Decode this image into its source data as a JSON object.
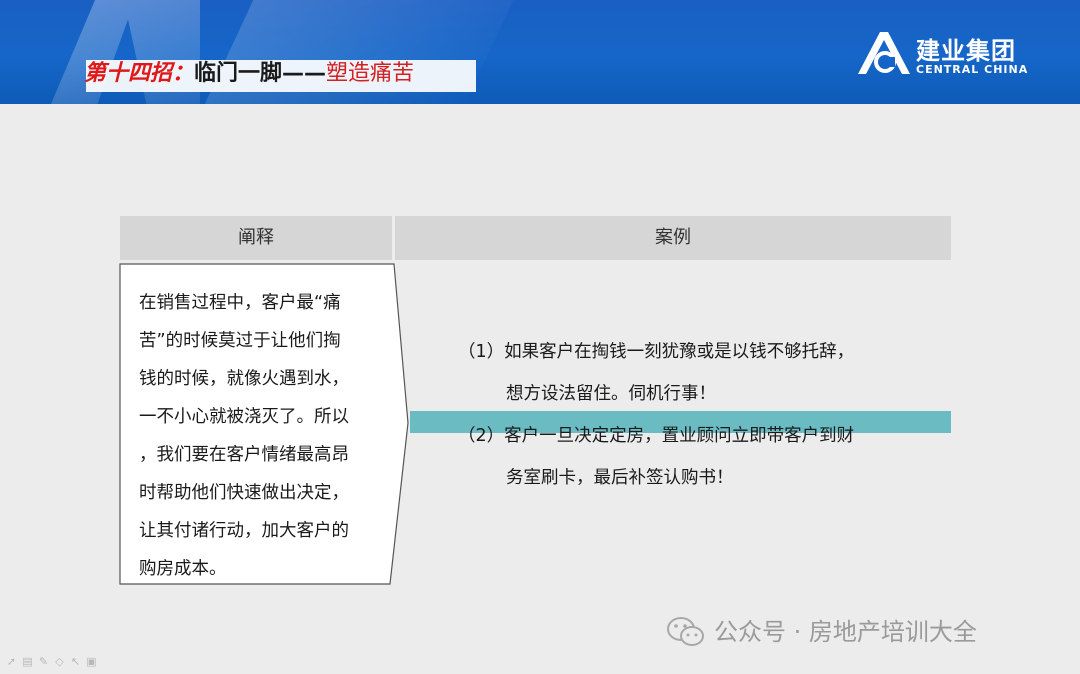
{
  "header": {
    "title_part1": "第十四招：",
    "title_part2": "临门一脚——",
    "title_part3": "塑造痛苦",
    "logo_cn": "建业集团",
    "logo_en": "CENTRAL CHINA"
  },
  "table": {
    "col_left_label": "阐释",
    "col_right_label": "案例",
    "explanation": "在销售过程中，客户最“痛\n苦”的时候莫过于让他们掏\n钱的时候，就像火遇到水，\n一不小心就被浇灭了。所以\n，我们要在客户情绪最高昂\n时帮助他们快速做出决定，\n让其付诸行动，加大客户的\n购房成本。",
    "cases": [
      {
        "line1": "（1）如果客户在掏钱一刻犹豫或是以钱不够托辞，",
        "line2": "想方设法留住。伺机行事！"
      },
      {
        "line1": "（2）客户一旦决定定房，置业顾问立即带客户到财",
        "line2": "务室刷卡，最后补签认购书！"
      }
    ]
  },
  "watermark": {
    "icon": "wechat-icon",
    "text": "公众号 · 房地产培训大全"
  },
  "toolbar": {
    "icons": [
      "arrow-icon",
      "slides-icon",
      "pen-icon",
      "eraser-icon",
      "pointer-icon",
      "camera-icon"
    ]
  },
  "colors": {
    "header_blue": "#1566c8",
    "title_red": "#e01818",
    "teal_bar": "#6bbbc2",
    "col_head_bg": "#d6d6d6"
  }
}
